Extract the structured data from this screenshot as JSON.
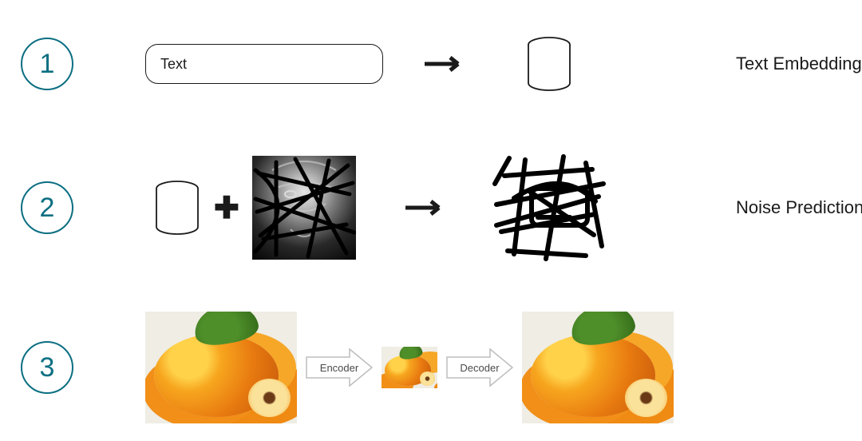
{
  "steps": {
    "1": {
      "badge": "1",
      "input": "Text",
      "output": "Text Embedding"
    },
    "2": {
      "badge": "2",
      "output": "Noise Prediction"
    },
    "3": {
      "badge": "3",
      "encoder": "Encoder",
      "decoder": "Decoder"
    }
  },
  "icons": {
    "arrow": "arrow-right",
    "cylinder": "database-cylinder",
    "plus": "plus",
    "block_arrow": "block-arrow-right"
  },
  "images": {
    "noisy_source": "grayscale-yoda-face-with-black-scribbles",
    "noise_pattern": "black-scribble-noise",
    "fruit_photo": "apricots-pile-photo"
  }
}
